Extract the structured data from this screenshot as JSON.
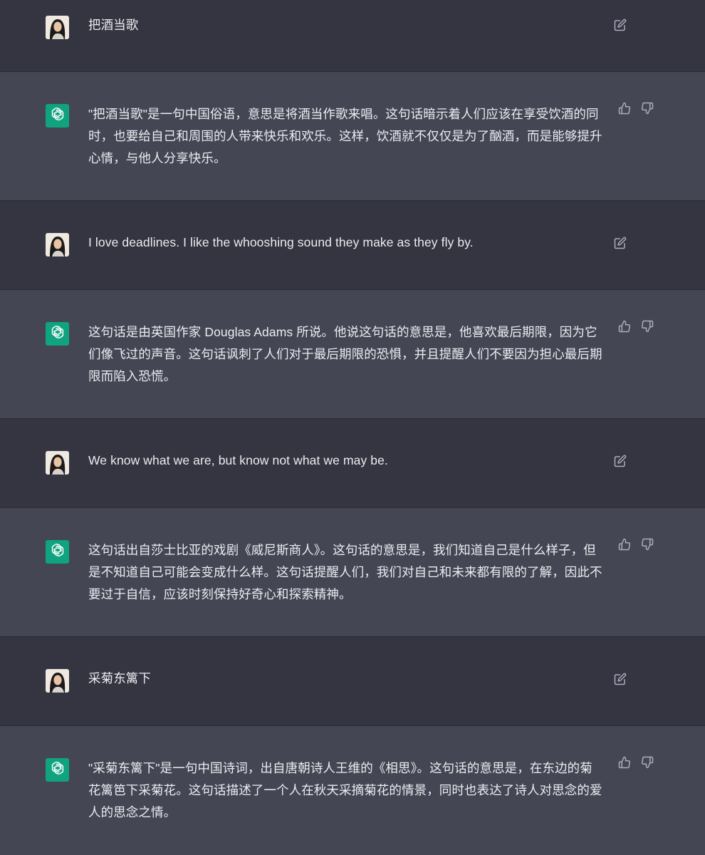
{
  "messages": [
    {
      "role": "user",
      "text": "把酒当歌",
      "avatar_icon": "user-photo-avatar",
      "action_icon": "edit-icon"
    },
    {
      "role": "assistant",
      "text": "\"把酒当歌\"是一句中国俗语，意思是将酒当作歌来唱。这句话暗示着人们应该在享受饮酒的同时，也要给自己和周围的人带来快乐和欢乐。这样，饮酒就不仅仅是为了酗酒，而是能够提升心情，与他人分享快乐。",
      "avatar_icon": "openai-logo-icon",
      "action_icons": [
        "thumbs-up-icon",
        "thumbs-down-icon"
      ]
    },
    {
      "role": "user",
      "text": "I love deadlines. I like the whooshing sound they make as they fly by.",
      "avatar_icon": "user-photo-avatar",
      "action_icon": "edit-icon"
    },
    {
      "role": "assistant",
      "text": "这句话是由英国作家 Douglas Adams 所说。他说这句话的意思是，他喜欢最后期限，因为它们像飞过的声音。这句话讽刺了人们对于最后期限的恐惧，并且提醒人们不要因为担心最后期限而陷入恐慌。",
      "avatar_icon": "openai-logo-icon",
      "action_icons": [
        "thumbs-up-icon",
        "thumbs-down-icon"
      ]
    },
    {
      "role": "user",
      "text": "We know what we are, but know not what we may be.",
      "avatar_icon": "user-photo-avatar",
      "action_icon": "edit-icon"
    },
    {
      "role": "assistant",
      "text": "这句话出自莎士比亚的戏剧《威尼斯商人》。这句话的意思是，我们知道自己是什么样子，但是不知道自己可能会变成什么样。这句话提醒人们，我们对自己和未来都有限的了解，因此不要过于自信，应该时刻保持好奇心和探索精神。",
      "avatar_icon": "openai-logo-icon",
      "action_icons": [
        "thumbs-up-icon",
        "thumbs-down-icon"
      ]
    },
    {
      "role": "user",
      "text": "采菊东篱下",
      "avatar_icon": "user-photo-avatar",
      "action_icon": "edit-icon"
    },
    {
      "role": "assistant",
      "text": "\"采菊东篱下\"是一句中国诗词，出自唐朝诗人王维的《相思》。这句话的意思是，在东边的菊花篱笆下采菊花。这句话描述了一个人在秋天采摘菊花的情景，同时也表达了诗人对思念的爱人的思念之情。",
      "avatar_icon": "openai-logo-icon",
      "action_icons": [
        "thumbs-up-icon",
        "thumbs-down-icon"
      ]
    }
  ],
  "colors": {
    "user_bg": "#343541",
    "assistant_bg": "#444654",
    "text": "#ececf1",
    "icon": "#acacbe",
    "brand": "#10a37f"
  }
}
